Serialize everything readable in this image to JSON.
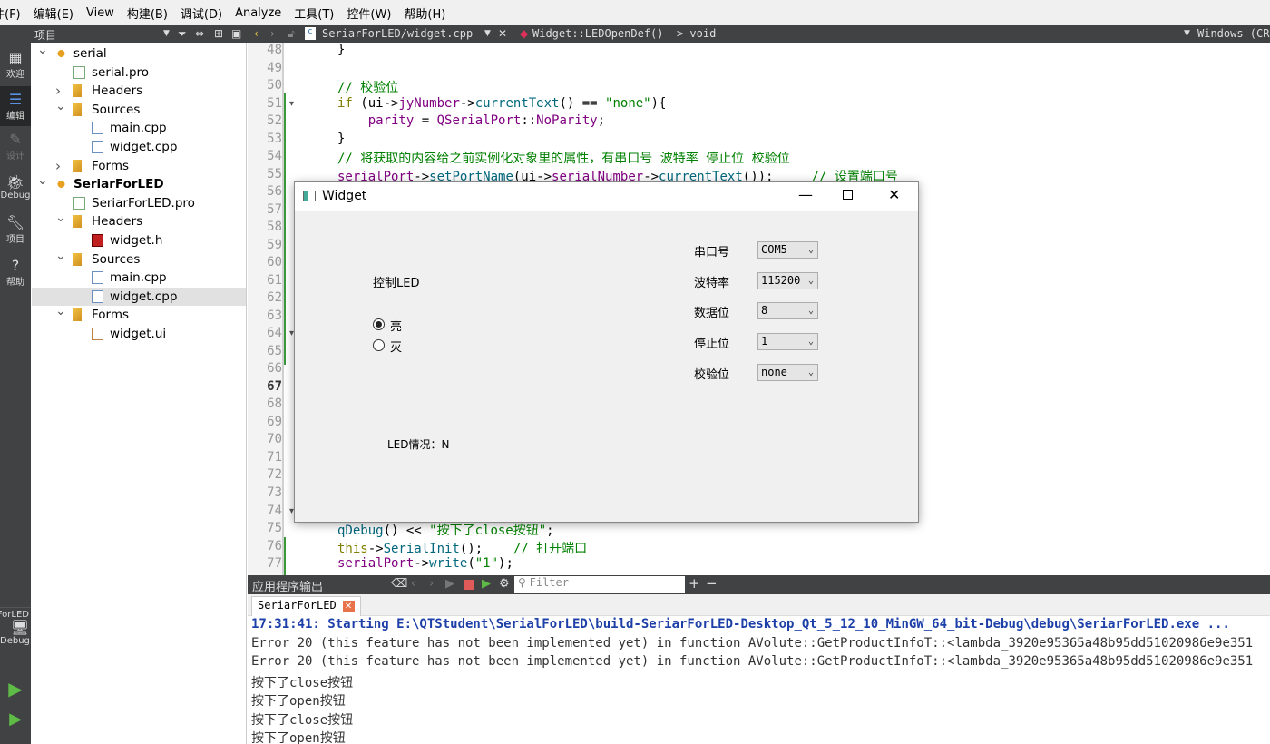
{
  "menubar": [
    "件(F)",
    "编辑(E)",
    "View",
    "构建(B)",
    "调试(D)",
    "Analyze",
    "工具(T)",
    "控件(W)",
    "帮助(H)"
  ],
  "toolbar": {
    "project_label": "项目",
    "file": "SeriarForLED/widget.cpp",
    "function": "Widget::LEDOpenDef() -> void",
    "encoding": "Windows (CRLF)"
  },
  "modes": [
    "欢迎",
    "编辑",
    "设计",
    "Debug",
    "项目",
    "帮助"
  ],
  "kit": {
    "name": "SeriarForLED",
    "mode": "Debug"
  },
  "tree": [
    {
      "label": "serial",
      "level": 0,
      "icon": "project-icon",
      "arrow": "open",
      "bold": false
    },
    {
      "label": "serial.pro",
      "level": 1,
      "icon": "pro-file-icon",
      "arrow": ""
    },
    {
      "label": "Headers",
      "level": 1,
      "icon": "folder-icon",
      "arrow": "closed"
    },
    {
      "label": "Sources",
      "level": 1,
      "icon": "folder-icon",
      "arrow": "open"
    },
    {
      "label": "main.cpp",
      "level": 2,
      "icon": "cpp-file-icon",
      "arrow": ""
    },
    {
      "label": "widget.cpp",
      "level": 2,
      "icon": "cpp-file-icon",
      "arrow": ""
    },
    {
      "label": "Forms",
      "level": 1,
      "icon": "folder-icon",
      "arrow": "closed"
    },
    {
      "label": "SeriarForLED",
      "level": 0,
      "icon": "project-icon",
      "arrow": "open",
      "bold": true
    },
    {
      "label": "SeriarForLED.pro",
      "level": 1,
      "icon": "pro-file-icon",
      "arrow": ""
    },
    {
      "label": "Headers",
      "level": 1,
      "icon": "folder-icon",
      "arrow": "open"
    },
    {
      "label": "widget.h",
      "level": 2,
      "icon": "header-file-icon",
      "arrow": ""
    },
    {
      "label": "Sources",
      "level": 1,
      "icon": "folder-icon",
      "arrow": "open"
    },
    {
      "label": "main.cpp",
      "level": 2,
      "icon": "cpp-file-icon",
      "arrow": ""
    },
    {
      "label": "widget.cpp",
      "level": 2,
      "icon": "cpp-file-icon",
      "arrow": "",
      "selected": true
    },
    {
      "label": "Forms",
      "level": 1,
      "icon": "folder-icon",
      "arrow": "open"
    },
    {
      "label": "widget.ui",
      "level": 2,
      "icon": "ui-file-icon",
      "arrow": ""
    }
  ],
  "editor": {
    "first_line": 48,
    "last_line": 77,
    "current_line": 67,
    "lines": {
      "48": [
        [
          "",
          "}"
        ]
      ],
      "50": [
        [
          "cm",
          "// 校验位"
        ]
      ],
      "51": [
        [
          "kw",
          "if"
        ],
        [
          "",
          " (ui->"
        ],
        [
          "mb",
          "jyNumber"
        ],
        [
          "",
          "->"
        ],
        [
          "fn",
          "currentText"
        ],
        [
          "",
          "() == "
        ],
        [
          "st",
          "\"none\""
        ],
        [
          "",
          "){"
        ]
      ],
      "52": [
        [
          "",
          "    "
        ],
        [
          "mb",
          "parity"
        ],
        [
          "",
          " = "
        ],
        [
          "mb",
          "QSerialPort"
        ],
        [
          "",
          "::"
        ],
        [
          "mb",
          "NoParity"
        ],
        [
          "",
          ";"
        ]
      ],
      "53": [
        [
          "",
          "}"
        ]
      ],
      "54": [
        [
          "cm",
          "// 将获取的内容给之前实例化对象里的属性，有串口号 波特率 停止位 校验位"
        ]
      ],
      "55": [
        [
          "mb",
          "serialPort"
        ],
        [
          "",
          "->"
        ],
        [
          "fn",
          "setPortName"
        ],
        [
          "",
          "(ui->"
        ],
        [
          "mb",
          "serialNumber"
        ],
        [
          "",
          "->"
        ],
        [
          "fn",
          "currentText"
        ],
        [
          "",
          "());     "
        ],
        [
          "cm",
          "// 设置端口号"
        ]
      ],
      "75": [
        [
          "fn",
          "qDebug"
        ],
        [
          "",
          "() << "
        ],
        [
          "st",
          "\"按下了close按钮\""
        ],
        [
          "",
          ";"
        ]
      ],
      "76": [
        [
          "kw",
          "this"
        ],
        [
          "",
          "->"
        ],
        [
          "fn",
          "SerialInit"
        ],
        [
          "",
          "();    "
        ],
        [
          "cm",
          "// 打开端口"
        ]
      ],
      "77": [
        [
          "mb",
          "serialPort"
        ],
        [
          "",
          "->"
        ],
        [
          "fn",
          "write"
        ],
        [
          "",
          "("
        ],
        [
          "st",
          "\"1\""
        ],
        [
          "",
          ");"
        ]
      ]
    },
    "fold_lines": [
      51,
      64,
      74
    ]
  },
  "output": {
    "title": "应用程序输出",
    "filter_placeholder": "Filter",
    "tab": "SeriarForLED",
    "lines": [
      "17:31:41: Starting E:\\QTStudent\\SerialForLED\\build-SeriarForLED-Desktop_Qt_5_12_10_MinGW_64_bit-Debug\\debug\\SeriarForLED.exe ...",
      "Error 20 (this feature has not been implemented yet) in function AVolute::GetProductInfoT::<lambda_3920e95365a48b95dd51020986e9e351",
      "Error 20 (this feature has not been implemented yet) in function AVolute::GetProductInfoT::<lambda_3920e95365a48b95dd51020986e9e351",
      "按下了close按钮",
      "按下了open按钮",
      "按下了close按钮",
      "按下了open按钮"
    ]
  },
  "widget": {
    "title": "Widget",
    "led_label": "控制LED",
    "radio_on": "亮",
    "radio_off": "灭",
    "radio_selected": "亮",
    "status": "LED情况：N",
    "fields": [
      {
        "label": "串口号",
        "value": "COM5"
      },
      {
        "label": "波特率",
        "value": "115200"
      },
      {
        "label": "数据位",
        "value": "8"
      },
      {
        "label": "停止位",
        "value": "1"
      },
      {
        "label": "校验位",
        "value": "none"
      }
    ]
  }
}
